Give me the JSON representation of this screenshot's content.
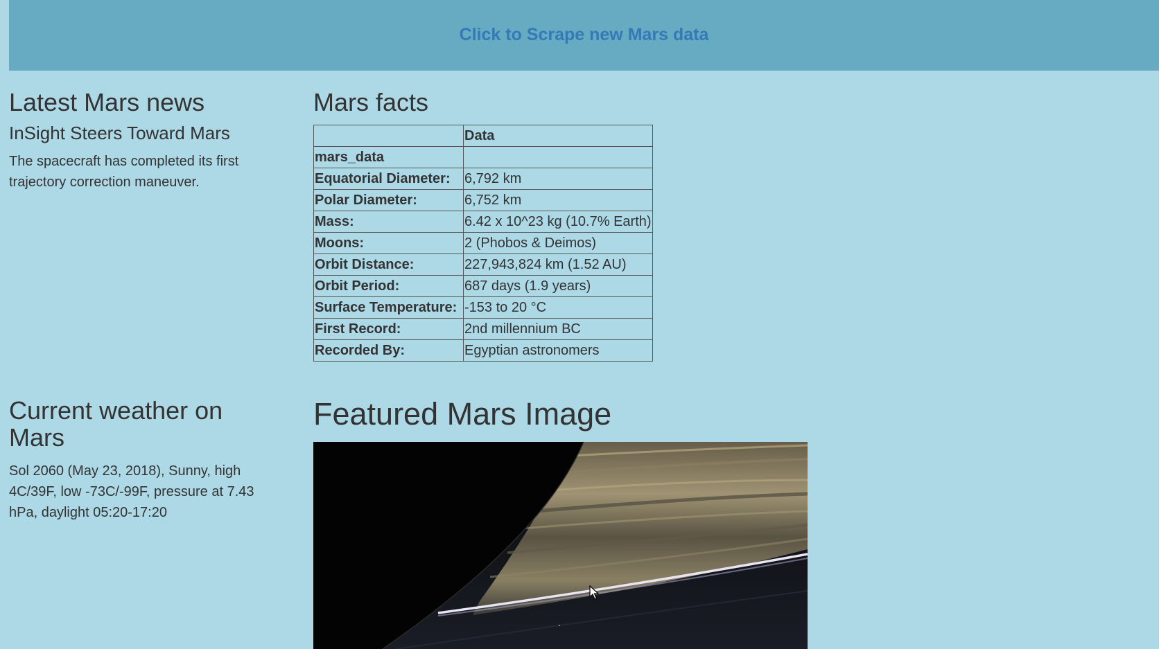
{
  "header": {
    "scrape_button_label": "Click to Scrape new Mars data"
  },
  "news": {
    "heading": "Latest Mars news",
    "title": "InSight Steers Toward Mars",
    "body": "The spacecraft has completed its first trajectory correction maneuver."
  },
  "facts": {
    "heading": "Mars facts",
    "column_header": "Data",
    "index_name": "mars_data",
    "rows": [
      {
        "label": "Equatorial Diameter:",
        "value": "6,792 km"
      },
      {
        "label": "Polar Diameter:",
        "value": "6,752 km"
      },
      {
        "label": "Mass:",
        "value": "6.42 x 10^23 kg (10.7% Earth)"
      },
      {
        "label": "Moons:",
        "value": "2 (Phobos & Deimos)"
      },
      {
        "label": "Orbit Distance:",
        "value": "227,943,824 km (1.52 AU)"
      },
      {
        "label": "Orbit Period:",
        "value": "687 days (1.9 years)"
      },
      {
        "label": "Surface Temperature:",
        "value": "-153 to 20 °C"
      },
      {
        "label": "First Record:",
        "value": "2nd millennium BC"
      },
      {
        "label": "Recorded By:",
        "value": "Egyptian astronomers"
      }
    ]
  },
  "weather": {
    "heading": "Current weather on Mars",
    "text": "Sol 2060 (May 23, 2018), Sunny, high 4C/39F, low -73C/-99F, pressure at 7.43 hPa, daylight 05:20-17:20"
  },
  "featured": {
    "heading": "Featured Mars Image"
  },
  "colors": {
    "page_background": "#add8e6",
    "jumbotron_background": "#66abc2",
    "link": "#337ab7",
    "text": "#333333"
  }
}
